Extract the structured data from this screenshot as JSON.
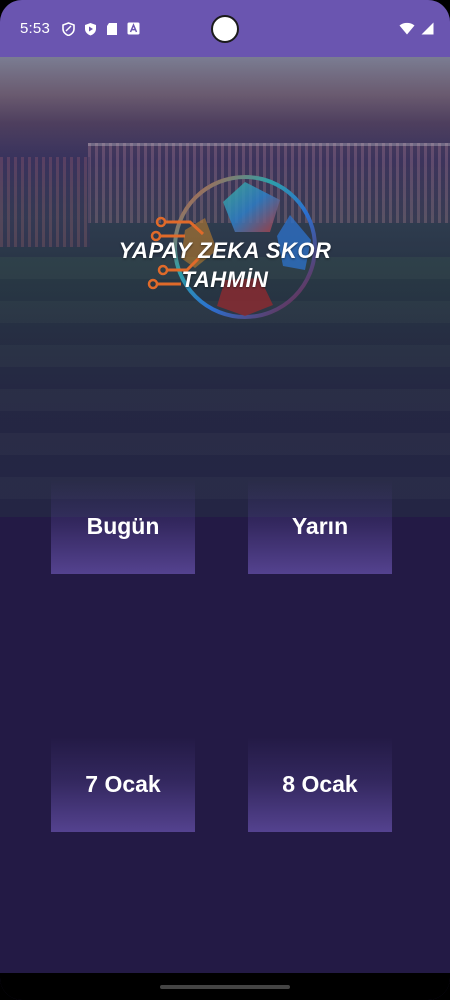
{
  "status_bar": {
    "time": "5:53",
    "left_icons": [
      "shield-icon",
      "play-protect-icon",
      "sd-card-icon",
      "keyboard-a-icon"
    ],
    "right_icons": [
      "wifi-icon",
      "signal-icon"
    ]
  },
  "logo": {
    "line1": "YAPAY ZEKA SKOR",
    "line2": "TAHMİN",
    "icon": "ai-soccer-ball-logo"
  },
  "buttons": {
    "today": "Bugün",
    "tomorrow": "Yarın",
    "day3": "7 Ocak",
    "day4": "8 Ocak"
  },
  "colors": {
    "status_bar": "#6a55b0",
    "background": "#231a45",
    "button": "#54428f",
    "text": "#ffffff"
  }
}
